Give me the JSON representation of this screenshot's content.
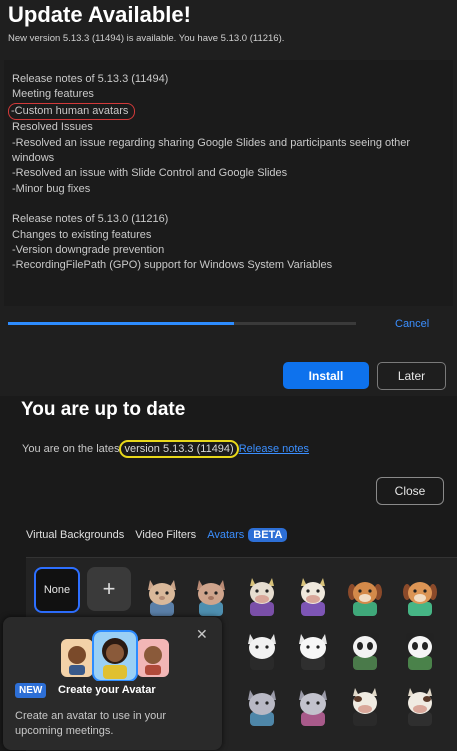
{
  "update": {
    "title": "Update Available!",
    "subtitle": "New version 5.13.3 (11494) is available. You have 5.13.0 (11216).",
    "notes": {
      "line1": "Release notes of 5.13.3 (11494)",
      "line2": "Meeting features",
      "line3": "-Custom human avatars",
      "line4": "Resolved Issues",
      "line5": "-Resolved an issue regarding sharing Google Slides and participants seeing other windows",
      "line6": "-Resolved an issue with Slide Control and Google Slides",
      "line7": "-Minor bug fixes",
      "line8": "Release notes of 5.13.0 (11216)",
      "line9": "Changes to existing features",
      "line10": "-Version downgrade prevention",
      "line11": "-RecordingFilePath (GPO) support for Windows System Variables"
    },
    "progress_fraction": 0.65,
    "cancel_label": "Cancel",
    "install_label": "Install",
    "later_label": "Later"
  },
  "uptodate": {
    "title": "You are up to date",
    "text_prefix": "You are on the lates",
    "version": "version 5.13.3 (11494)",
    "release_notes_link": "Release notes",
    "close_label": "Close"
  },
  "avatars": {
    "tabs": [
      "Virtual Backgrounds",
      "Video Filters",
      "Avatars"
    ],
    "beta_label": "BETA",
    "none_label": "None",
    "add_symbol": "+",
    "colors": {
      "accent": "#2d8cff",
      "highlight_red": "#d23a3a",
      "highlight_yellow": "#e8d81a"
    }
  },
  "popup": {
    "close_symbol": "✕",
    "new_label": "NEW",
    "title": "Create your Avatar",
    "description": "Create an avatar to use in your upcoming meetings."
  }
}
